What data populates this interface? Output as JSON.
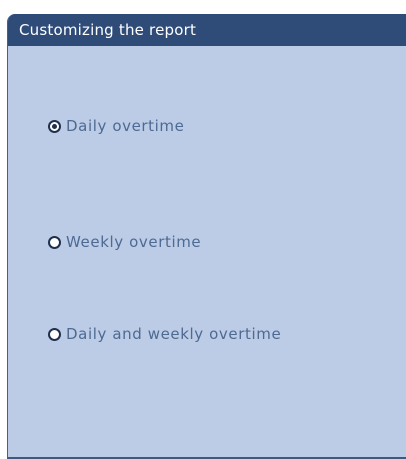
{
  "panel": {
    "title": "Customizing the report"
  },
  "options": [
    {
      "label": "Daily overtime",
      "selected": true
    },
    {
      "label": "Weekly overtime",
      "selected": false
    },
    {
      "label": "Daily and weekly overtime",
      "selected": false
    }
  ]
}
